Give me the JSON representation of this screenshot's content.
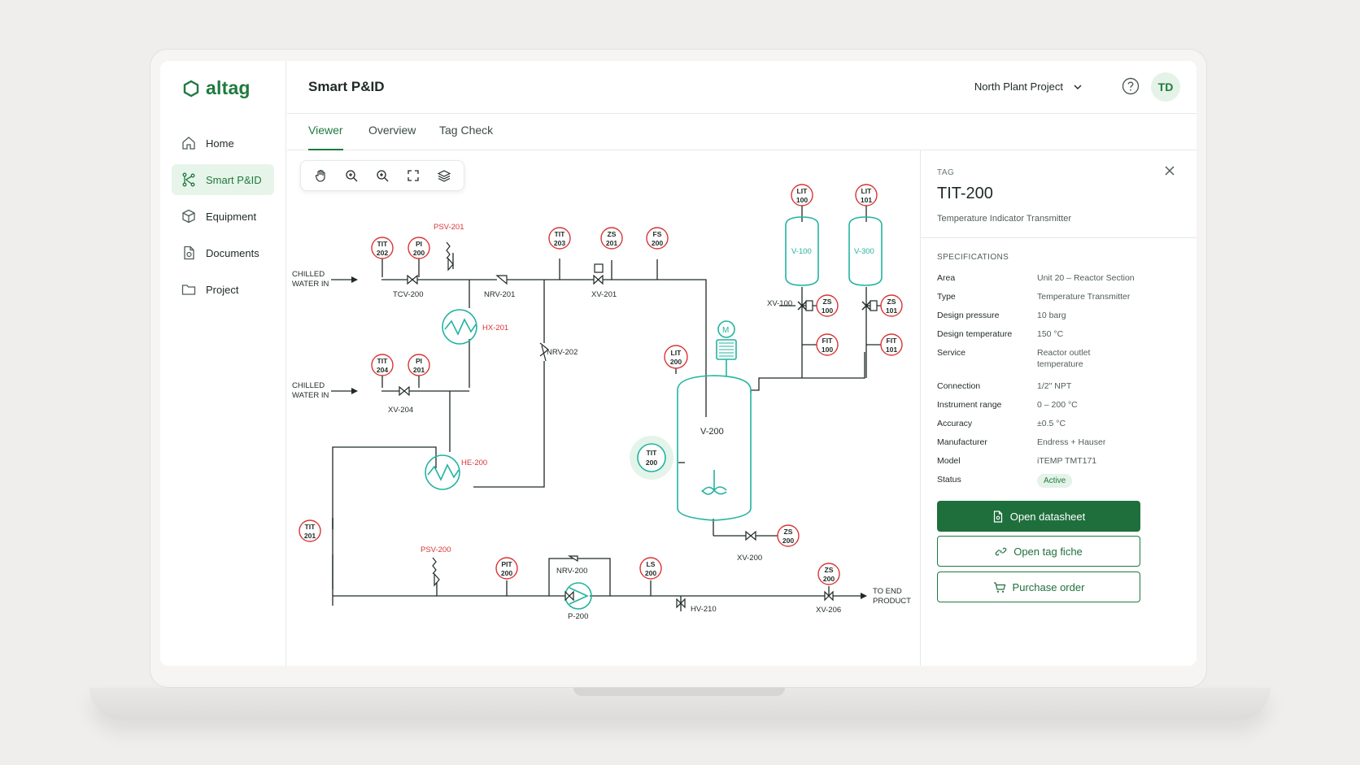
{
  "app": {
    "name": "altag"
  },
  "sidebar": {
    "items": [
      {
        "label": "Home",
        "icon": "home-icon"
      },
      {
        "label": "Smart P&ID",
        "icon": "pid-icon"
      },
      {
        "label": "Equipment",
        "icon": "cube-icon"
      },
      {
        "label": "Documents",
        "icon": "document-icon"
      },
      {
        "label": "Project",
        "icon": "folder-icon"
      }
    ]
  },
  "header": {
    "title": "Smart P&ID",
    "project": "North Plant Project",
    "avatar_initials": "TD"
  },
  "tabs": [
    {
      "label": "Viewer"
    },
    {
      "label": "Overview"
    },
    {
      "label": "Tag Check"
    }
  ],
  "toolbar": {
    "tools": [
      "hand-icon",
      "zoom-in-icon",
      "zoom-out-icon",
      "fullscreen-icon",
      "layers-icon"
    ]
  },
  "diagram": {
    "lines_text": [
      "CHILLED",
      "WATER IN",
      "TO END",
      "PRODUCT"
    ],
    "instruments": [
      {
        "top": "TIT",
        "bottom": "202"
      },
      {
        "top": "PI",
        "bottom": "200"
      },
      {
        "top": "TIT",
        "bottom": "203"
      },
      {
        "top": "ZS",
        "bottom": "201"
      },
      {
        "top": "FS",
        "bottom": "200"
      },
      {
        "top": "TIT",
        "bottom": "204"
      },
      {
        "top": "PI",
        "bottom": "201"
      },
      {
        "top": "LIT",
        "bottom": "200"
      },
      {
        "top": "TIT",
        "bottom": "200"
      },
      {
        "top": "LIT",
        "bottom": "100"
      },
      {
        "top": "LIT",
        "bottom": "101"
      },
      {
        "top": "ZS",
        "bottom": "100"
      },
      {
        "top": "ZS",
        "bottom": "101"
      },
      {
        "top": "FIT",
        "bottom": "100"
      },
      {
        "top": "FIT",
        "bottom": "101"
      },
      {
        "top": "TIT",
        "bottom": "201"
      },
      {
        "top": "PIT",
        "bottom": "200"
      },
      {
        "top": "LS",
        "bottom": "200"
      },
      {
        "top": "ZS",
        "bottom": "200"
      },
      {
        "top": "ZS",
        "bottom": "200"
      }
    ],
    "labels": {
      "psv201": "PSV-201",
      "tcv200": "TCV-200",
      "nrv201": "NRV-201",
      "xv201": "XV-201",
      "hx201": "HX-201",
      "nrv202": "NRV-202",
      "xv204": "XV-204",
      "he200": "HE-200",
      "v200": "V-200",
      "v100": "V-100",
      "v300": "V-300",
      "xv100": "XV-100",
      "xv200": "XV-200",
      "psv200": "PSV-200",
      "nrv200": "NRV-200",
      "p200": "P-200",
      "hv210": "HV-210",
      "xv206": "XV-206",
      "motor": "M"
    }
  },
  "panel": {
    "section_label": "TAG",
    "tag": "TIT-200",
    "description": "Temperature Indicator Transmitter",
    "spec_title": "SPECIFICATIONS",
    "specs": [
      {
        "key": "Area",
        "value": "Unit 20 – Reactor Section"
      },
      {
        "key": "Type",
        "value": "Temperature Transmitter"
      },
      {
        "key": "Design pressure",
        "value": "10 barg"
      },
      {
        "key": "Design temperature",
        "value": "150 °C"
      },
      {
        "key": "Service",
        "value": "Reactor outlet temperature"
      },
      {
        "key": "Connection",
        "value": "1/2\" NPT"
      },
      {
        "key": "Instrument range",
        "value": "0 – 200 °C"
      },
      {
        "key": "Accuracy",
        "value": "±0.5 °C"
      },
      {
        "key": "Manufacturer",
        "value": "Endress + Hauser"
      },
      {
        "key": "Model",
        "value": "iTEMP TMT171"
      }
    ],
    "status_key": "Status",
    "status_value": "Active",
    "buttons": {
      "datasheet": "Open datasheet",
      "tag_fiche": "Open tag fiche",
      "purchase": "Purchase order"
    }
  },
  "colors": {
    "brand": "#1f7a3f",
    "instrument": "#d93434",
    "equipment": "#22b3a0",
    "line": "#1f2a24"
  }
}
